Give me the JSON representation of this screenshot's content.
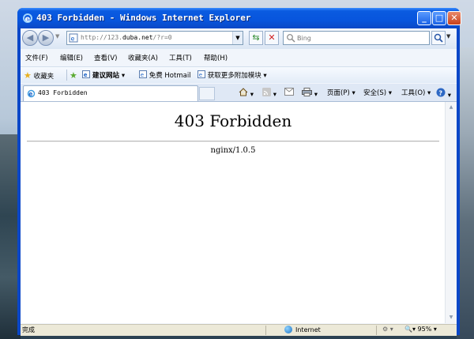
{
  "window": {
    "title": "403 Forbidden - Windows Internet Explorer"
  },
  "nav": {
    "address": {
      "prefix": "http://123.",
      "domain": "duba.net",
      "suffix": "/?r=0"
    },
    "search_placeholder": "Bing"
  },
  "menu": [
    "文件(F)",
    "编辑(E)",
    "查看(V)",
    "收藏夹(A)",
    "工具(T)",
    "帮助(H)"
  ],
  "favorites": {
    "label": "收藏夹",
    "items": [
      "建议网站 ▾",
      "免费 Hotmail",
      "获取更多附加模块 ▾"
    ]
  },
  "tab": {
    "label": "403 Forbidden"
  },
  "commands": [
    "页面(P) ▾",
    "安全(S) ▾",
    "工具(O) ▾"
  ],
  "page": {
    "heading": "403 Forbidden",
    "server": "nginx/1.0.5"
  },
  "status": {
    "text": "完成",
    "zone": "Internet",
    "zoom": "95%"
  }
}
